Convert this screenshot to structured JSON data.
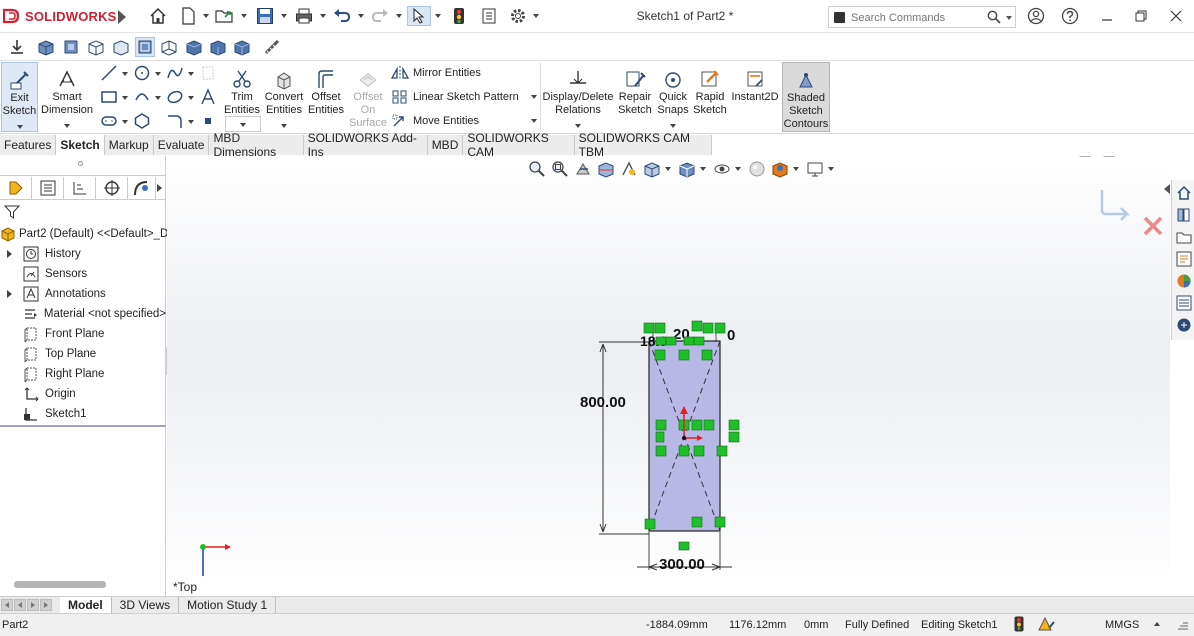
{
  "app": {
    "brand": "SOLIDWORKS",
    "document_title": "Sketch1 of Part2 *",
    "search": {
      "placeholder": "Search Commands"
    }
  },
  "command_manager": {
    "exit_sketch": "Exit Sketch",
    "smart_dimension": "Smart Dimension",
    "trim_entities": "Trim Entities",
    "convert_entities": "Convert Entities",
    "offset_entities": "Offset Entities",
    "offset_on_surface": "Offset On Surface",
    "mirror_entities": "Mirror Entities",
    "linear_sketch_pattern": "Linear Sketch Pattern",
    "move_entities": "Move Entities",
    "display_delete_relations": "Display/Delete Relations",
    "repair_sketch": "Repair Sketch",
    "quick_snaps": "Quick Snaps",
    "rapid_sketch": "Rapid Sketch",
    "instant2d": "Instant2D",
    "shaded_sketch_contours": "Shaded Sketch Contours"
  },
  "tabs": [
    {
      "label": "Features",
      "active": false
    },
    {
      "label": "Sketch",
      "active": true
    },
    {
      "label": "Markup",
      "active": false
    },
    {
      "label": "Evaluate",
      "active": false
    },
    {
      "label": "MBD Dimensions",
      "active": false
    },
    {
      "label": "SOLIDWORKS Add-Ins",
      "active": false
    },
    {
      "label": "MBD",
      "active": false
    },
    {
      "label": "SOLIDWORKS CAM",
      "active": false
    },
    {
      "label": "SOLIDWORKS CAM TBM",
      "active": false
    }
  ],
  "feature_tree": {
    "root": "Part2 (Default) <<Default>_D",
    "items": [
      {
        "label": "History",
        "icon": "history-icon",
        "expandable": true
      },
      {
        "label": "Sensors",
        "icon": "sensors-icon",
        "expandable": false
      },
      {
        "label": "Annotations",
        "icon": "annotations-icon",
        "expandable": true
      },
      {
        "label": "Material <not specified>",
        "icon": "material-icon",
        "expandable": false
      },
      {
        "label": "Front Plane",
        "icon": "plane-icon",
        "expandable": false
      },
      {
        "label": "Top Plane",
        "icon": "plane-icon",
        "expandable": false
      },
      {
        "label": "Right Plane",
        "icon": "plane-icon",
        "expandable": false
      },
      {
        "label": "Origin",
        "icon": "origin-icon",
        "expandable": false
      },
      {
        "label": "Sketch1",
        "icon": "sketch-icon",
        "expandable": false
      }
    ]
  },
  "sketch": {
    "height_dimension": "800.00",
    "width_dimension": "300.00",
    "top_label_left": "18.0",
    "top_label_mid": "20",
    "top_label_right": "0",
    "view_name": "*Top",
    "fill_color": "#b8b8e6",
    "relation_color": "#1fbf2a"
  },
  "bottom_tabs": [
    {
      "label": "Model",
      "active": true
    },
    {
      "label": "3D Views",
      "active": false
    },
    {
      "label": "Motion Study 1",
      "active": false
    }
  ],
  "status": {
    "document": "Part2",
    "x": "-1884.09mm",
    "y": "1176.12mm",
    "z": "0mm",
    "definition": "Fully Defined",
    "mode": "Editing Sketch1",
    "units": "MMGS"
  }
}
